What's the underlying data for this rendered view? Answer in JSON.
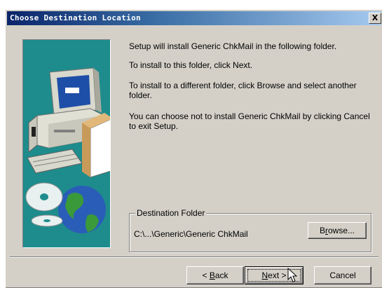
{
  "window": {
    "title": "Choose Destination Location",
    "close_label": "X"
  },
  "content": {
    "line1": "Setup will install Generic ChkMail in the following folder.",
    "line2": "To install to this folder, click Next.",
    "line3": "To install to a different folder, click Browse and select another folder.",
    "line4": "You can choose not to install Generic ChkMail by clicking Cancel to exit Setup."
  },
  "destination": {
    "legend": "Destination Folder",
    "path": "C:\\...\\Generic\\Generic ChkMail",
    "browse_label_pre": "B",
    "browse_label_u": "r",
    "browse_label_post": "owse..."
  },
  "buttons": {
    "back_pre": "< ",
    "back_u": "B",
    "back_post": "ack",
    "next_u": "N",
    "next_post": "ext >",
    "cancel": "Cancel"
  },
  "colors": {
    "titlebar": "#0a246a",
    "dialog": "#d4d0c8",
    "art_bg": "#1e8c8c"
  }
}
